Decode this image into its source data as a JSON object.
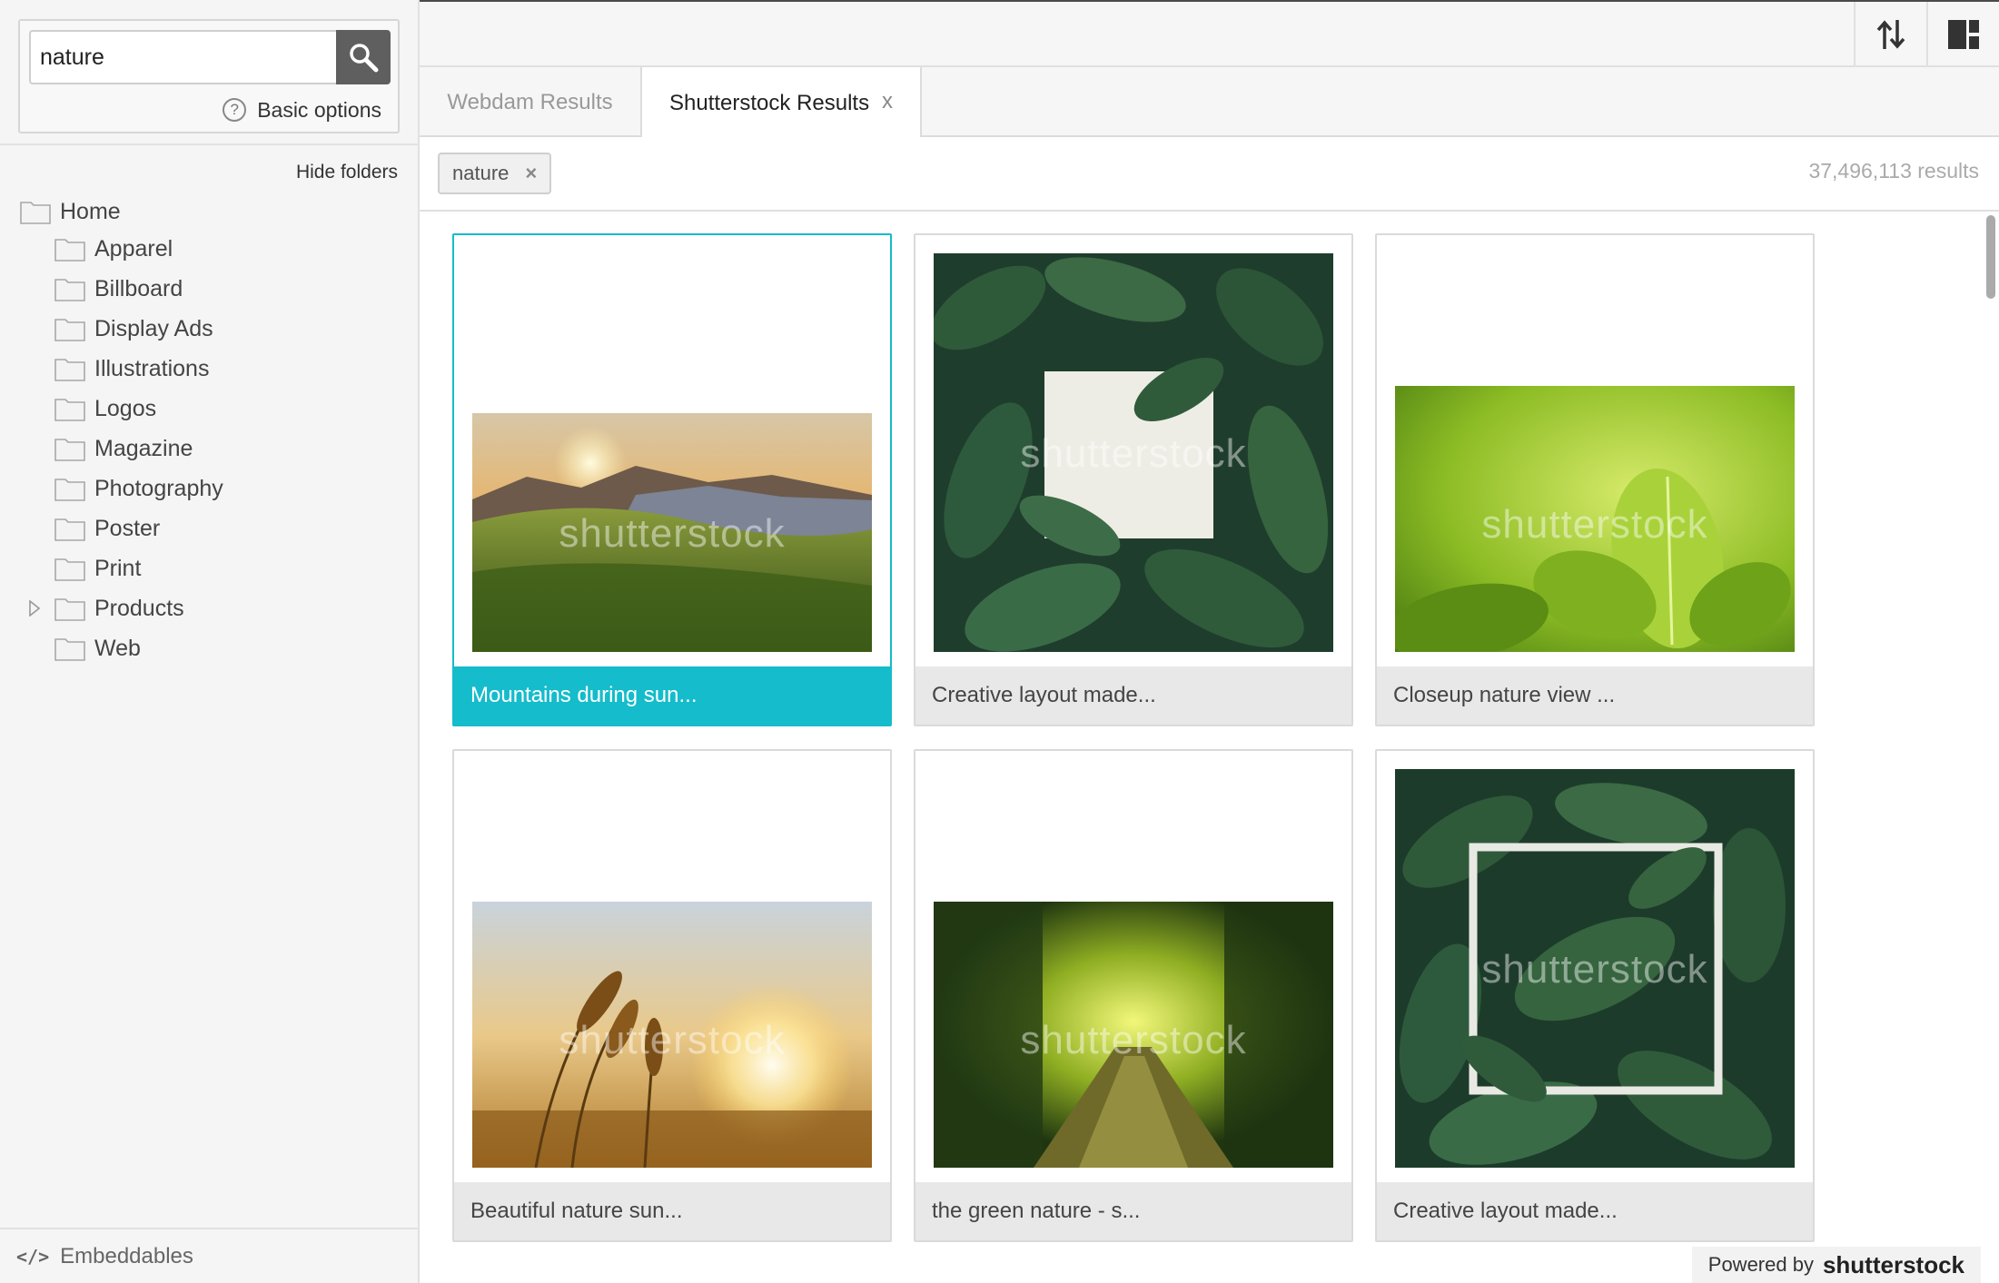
{
  "search": {
    "value": "nature",
    "options_label": "Basic options",
    "help_glyph": "?"
  },
  "sidebar": {
    "hide_folders_label": "Hide folders",
    "root": "Home",
    "folders": [
      "Apparel",
      "Billboard",
      "Display Ads",
      "Illustrations",
      "Logos",
      "Magazine",
      "Photography",
      "Poster",
      "Print",
      "Products",
      "Web"
    ],
    "embeddables_label": "Embeddables",
    "embeddables_glyph": "</>"
  },
  "tabs": [
    {
      "label": "Webdam Results"
    },
    {
      "label": "Shutterstock Results",
      "close": "x"
    }
  ],
  "filter": {
    "chip_label": "nature",
    "chip_close": "×",
    "results": "37,496,113 results"
  },
  "cards": [
    {
      "caption": "Mountains during sun...",
      "watermark": "shutterstock",
      "selected": true
    },
    {
      "caption": "Creative layout made...",
      "watermark": "shutterstock"
    },
    {
      "caption": "Closeup nature view ...",
      "watermark": "shutterstock"
    },
    {
      "caption": "Beautiful nature sun...",
      "watermark": "shutterstock"
    },
    {
      "caption": "the green nature - s...",
      "watermark": "shutterstock"
    },
    {
      "caption": "Creative layout made...",
      "watermark": "shutterstock"
    }
  ],
  "footer": {
    "powered_by": "Powered by",
    "brand": "shutterstock"
  },
  "colors": {
    "accent": "#15bccb",
    "search_button": "#5f5f5f"
  }
}
